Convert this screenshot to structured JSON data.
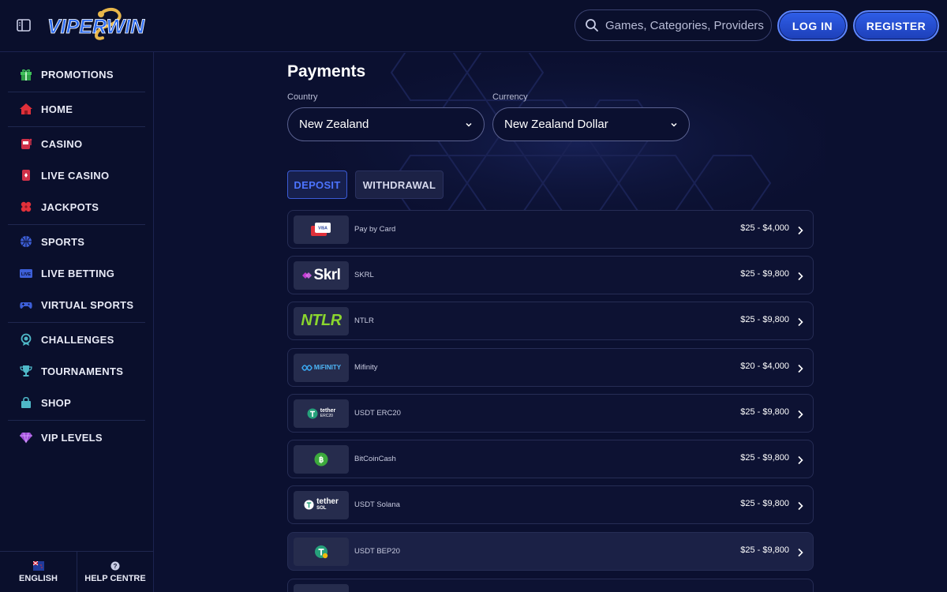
{
  "header": {
    "brand": "VIPERWIN",
    "search_placeholder": "Games, Categories, Providers",
    "login_label": "LOG IN",
    "register_label": "REGISTER"
  },
  "sidebar": {
    "items": [
      {
        "label": "PROMOTIONS",
        "icon": "gift-icon"
      },
      {
        "label": "HOME",
        "icon": "home-icon"
      },
      {
        "label": "CASINO",
        "icon": "slot-machine-icon"
      },
      {
        "label": "LIVE CASINO",
        "icon": "playing-card-icon"
      },
      {
        "label": "JACKPOTS",
        "icon": "clover-icon"
      },
      {
        "label": "SPORTS",
        "icon": "basketball-icon"
      },
      {
        "label": "LIVE BETTING",
        "icon": "live-tv-icon"
      },
      {
        "label": "VIRTUAL SPORTS",
        "icon": "gamepad-icon"
      },
      {
        "label": "CHALLENGES",
        "icon": "medal-icon"
      },
      {
        "label": "TOURNAMENTS",
        "icon": "trophy-icon"
      },
      {
        "label": "SHOP",
        "icon": "shopping-bag-icon"
      },
      {
        "label": "VIP LEVELS",
        "icon": "diamond-icon"
      }
    ],
    "footer": {
      "language_label": "ENGLISH",
      "help_label": "HELP CENTRE"
    }
  },
  "payments": {
    "title": "Payments",
    "country_label": "Country",
    "country_value": "New Zealand",
    "currency_label": "Currency",
    "currency_value": "New Zealand Dollar",
    "tabs": {
      "deposit": "DEPOSIT",
      "withdrawal": "WITHDRAWAL"
    },
    "methods": [
      {
        "name": "Pay by Card",
        "range": "$25 - $4,000",
        "logo": "card-logo"
      },
      {
        "name": "SKRL",
        "range": "$25 - $9,800",
        "logo_text": "Skrl"
      },
      {
        "name": "NTLR",
        "range": "$25 - $9,800",
        "logo_text": "NTLR"
      },
      {
        "name": "Mifinity",
        "range": "$20 - $4,000",
        "logo_text": "MiFINITY"
      },
      {
        "name": "USDT ERC20",
        "range": "$25 - $9,800",
        "logo_text": "tether",
        "logo_sub": "ERC20"
      },
      {
        "name": "BitCoinCash",
        "range": "$25 - $9,800",
        "logo": "bitcoincash-logo"
      },
      {
        "name": "USDT Solana",
        "range": "$25 - $9,800",
        "logo_text": "tether",
        "logo_sub": "SOL"
      },
      {
        "name": "USDT BEP20",
        "range": "$25 - $9,800",
        "logo": "tether-bep20-logo"
      }
    ]
  },
  "colors": {
    "background": "#0b1030",
    "accent_blue": "#2f5ee8",
    "deposit_active": "#4c74ff",
    "logo_gold": "#e8b64a",
    "logo_red": "#e0303a"
  }
}
